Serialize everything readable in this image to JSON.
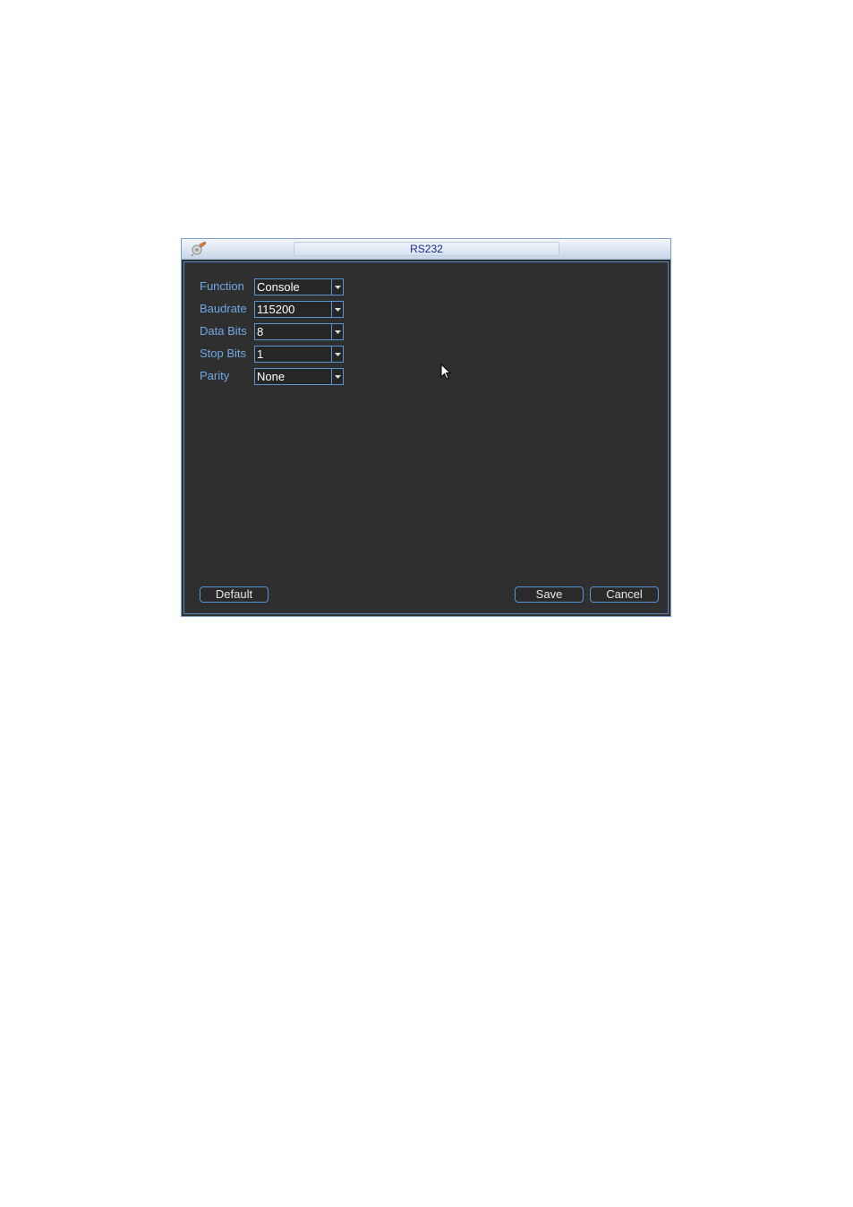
{
  "window": {
    "title": "RS232"
  },
  "fields": [
    {
      "label": "Function",
      "value": "Console"
    },
    {
      "label": "Baudrate",
      "value": "115200"
    },
    {
      "label": "Data Bits",
      "value": "8"
    },
    {
      "label": "Stop Bits",
      "value": "1"
    },
    {
      "label": "Parity",
      "value": "None"
    }
  ],
  "buttons": {
    "default_label": "Default",
    "save_label": "Save",
    "cancel_label": "Cancel"
  },
  "icons": {
    "title": "settings-tool-icon",
    "dropdown": "chevron-down-icon",
    "cursor": "mouse-pointer-icon"
  },
  "colors": {
    "background": "#2f2f2f",
    "label": "#6fa8e8",
    "border_accent": "#5a93d6",
    "title_text": "#1a2a8c",
    "value_text": "#ffffff"
  }
}
